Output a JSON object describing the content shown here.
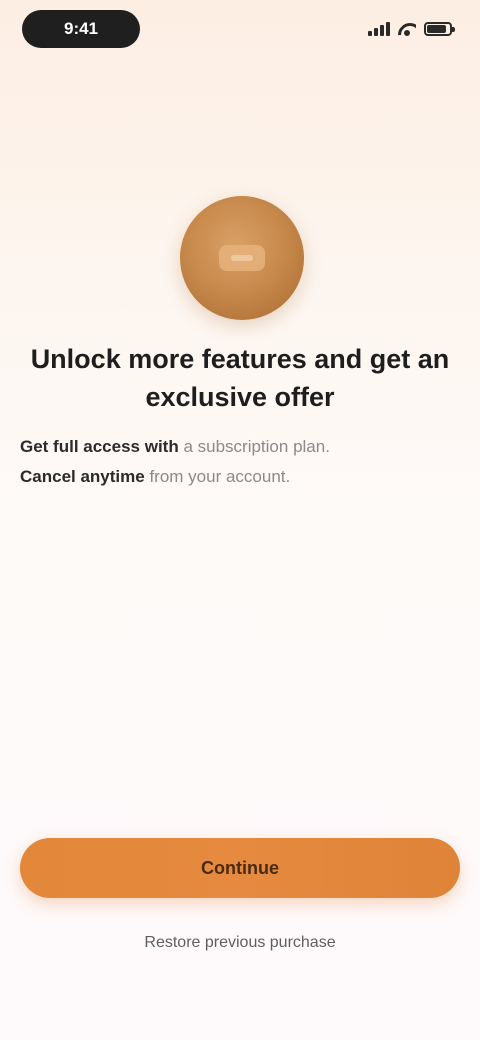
{
  "status_bar": {
    "time": "9:41",
    "icons": [
      "signal-icon",
      "wifi-icon",
      "battery-icon"
    ]
  },
  "hero": {
    "emblem_icon": "coin-emblem-icon",
    "headline": "Unlock more features and get an exclusive offer",
    "description_strong": "Get full access with",
    "description_rest": " a subscription plan.",
    "description_strong_2": "Cancel anytime",
    "description_rest_2": " from your account."
  },
  "actions": {
    "primary_label": "Continue",
    "secondary_label": "Restore previous purchase"
  },
  "colors": {
    "accent": "#e58a3e",
    "emblem": "#c98a4d",
    "background_top": "#fdeee3",
    "background_bottom": "#fef9fb"
  }
}
